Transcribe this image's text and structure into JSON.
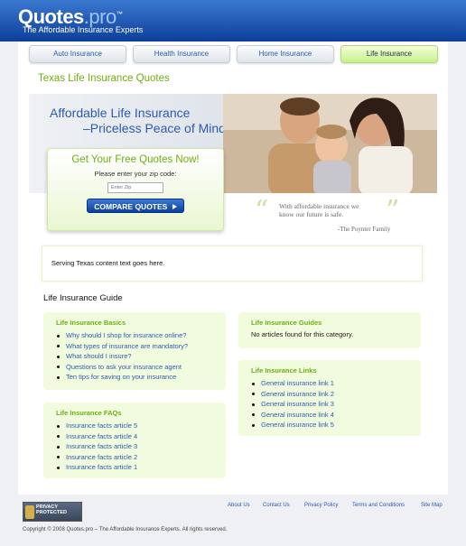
{
  "header": {
    "logo_main": "Quotes",
    "logo_suffix": ".pro",
    "logo_tm": "™",
    "tagline": "The Affordable Insurance Experts"
  },
  "tabs": [
    {
      "label": "Auto Insurance",
      "active": false
    },
    {
      "label": "Health Insurance",
      "active": false
    },
    {
      "label": "Home Insurance",
      "active": false
    },
    {
      "label": "Life Insurance",
      "active": true
    }
  ],
  "page_title": "Texas Life Insurance Quotes",
  "hero": {
    "line1": "Affordable Life Insurance",
    "line2": "–Priceless Peace of Mind."
  },
  "quote_form": {
    "title": "Get Your Free Quotes Now!",
    "prompt": "Please enter your zip code:",
    "zip_placeholder": "Enter Zip",
    "button_label": "COMPARE QUOTES",
    "button_icon": "triangle-right"
  },
  "testimonial": {
    "line1": "With affordable insurance we",
    "line2": "know our future is safe.",
    "author": "-The Poynter Family"
  },
  "serving_text": "Serving Texas content text goes here.",
  "guide": {
    "heading": "Life Insurance Guide",
    "basics": {
      "title": "Life Insurance Basics",
      "items": [
        "Why should I shop for insurance online?",
        "What types of insurance are mandatory?",
        "What should I insure?",
        "Questions to ask your insurance agent",
        "Ten tips for saving on your insurance"
      ]
    },
    "faqs": {
      "title": "Life Insurance FAQs",
      "items": [
        "Insurance facts article 5",
        "Insurance facts article 4",
        "Insurance facts article 3",
        "Insurance facts article 2",
        "Insurance facts article 1"
      ]
    },
    "guides": {
      "title": "Life Insurance Guides",
      "empty_text": "No articles found for this category."
    },
    "links": {
      "title": "Life Insurance Links",
      "items": [
        "General insurance link 1",
        "General insurance link 2",
        "General insurance link 3",
        "General insurance link 4",
        "General insurance link 5"
      ]
    }
  },
  "footer": {
    "links": [
      "About Us",
      "Contact Us",
      "Privacy Policy",
      "Terms and Conditions",
      "Site Map"
    ],
    "badge_line1": "PRIVACY",
    "badge_line2": "PROTECTED",
    "copyright": "Copyright © 2008 Quotes.pro – The Affordable Insurance Experts. All rights reserved."
  },
  "colors": {
    "brand_blue": "#0d3f9a",
    "link_blue": "#2a5bb0",
    "accent_green": "#6fae12",
    "panel_green": "#f1fbde"
  }
}
